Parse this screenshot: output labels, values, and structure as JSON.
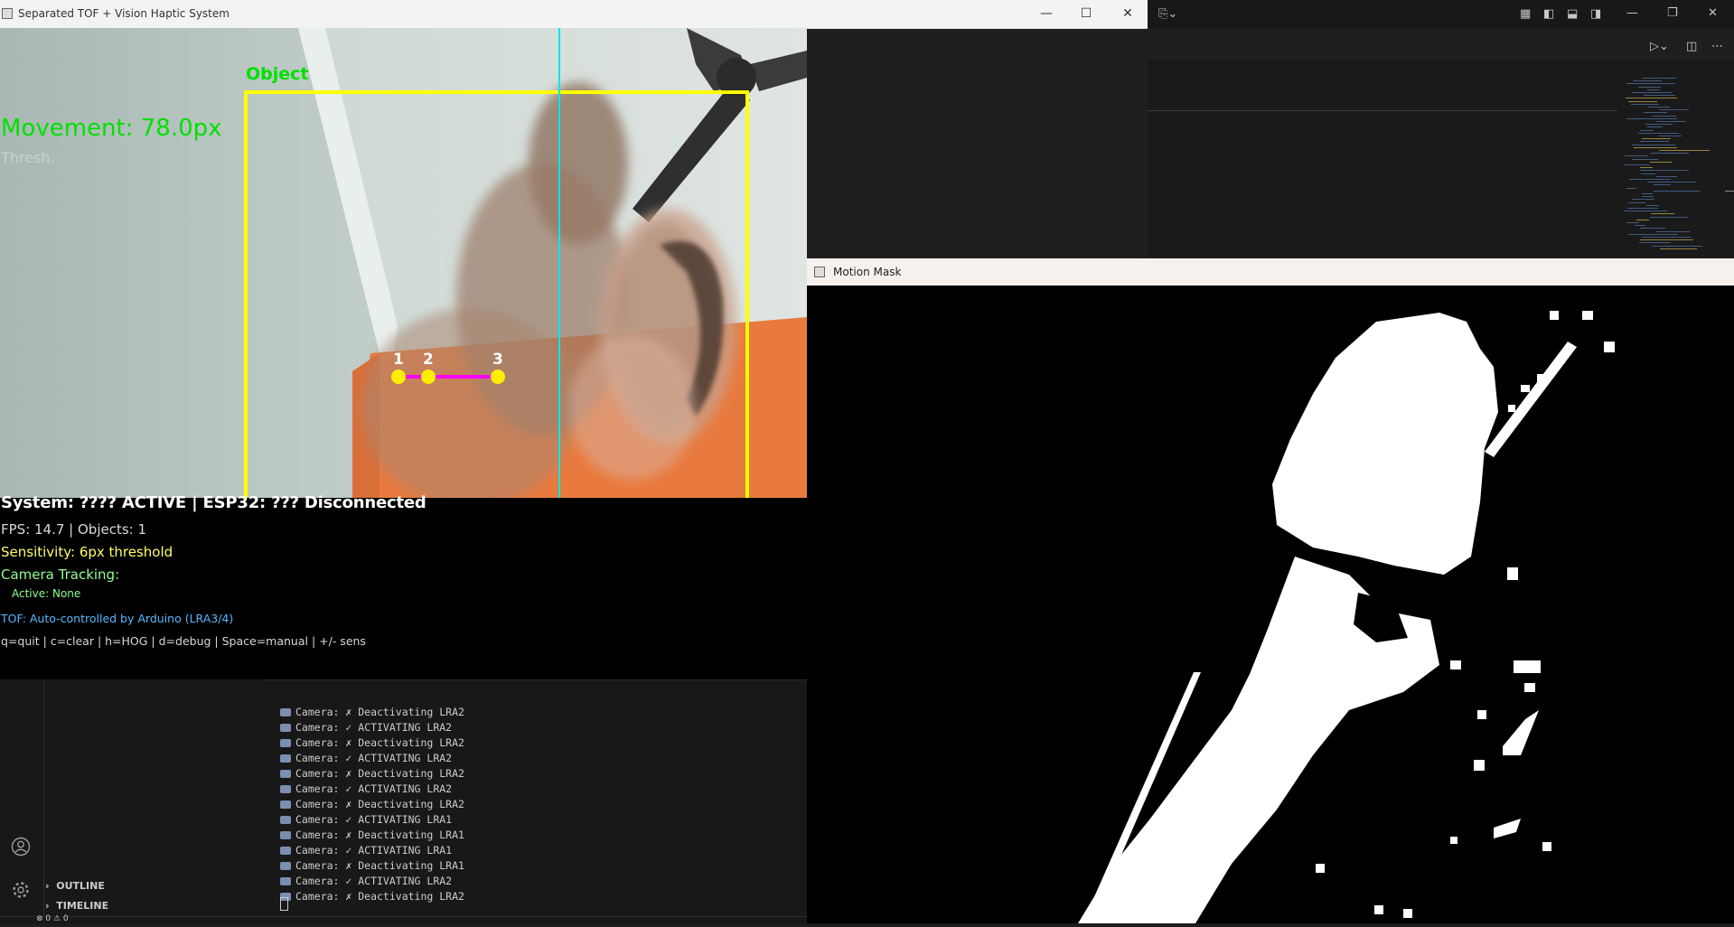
{
  "main_window": {
    "title": "Separated TOF + Vision Haptic System",
    "minimize": "—",
    "maximize": "☐",
    "close": "✕"
  },
  "camera_overlay": {
    "object_label": "Object",
    "movement": "Movement: 78.0px",
    "threshold_faint": "Thresh.",
    "points": [
      "1",
      "2",
      "3"
    ],
    "colors": {
      "box": "#ffff00",
      "movement_text": "#00e000",
      "center_line": "#00e6e6",
      "track_line": "#ff00ff",
      "points": "#ffee00"
    }
  },
  "hud": {
    "system_status": "System: ???? ACTIVE | ESP32: ??? Disconnected",
    "fps_objects": "FPS: 14.7 | Objects: 1",
    "sensitivity": "Sensitivity: 6px threshold",
    "camera_tracking": "Camera Tracking:",
    "active": "Active: None",
    "tof": "TOF: Auto-controlled by Arduino (LRA3/4)",
    "keys": "q=quit | c=clear | h=HOG | d=debug | Space=manual | +/- sens"
  },
  "mask_window": {
    "title": "Motion Mask"
  },
  "vscode": {
    "sections": [
      "OUTLINE",
      "TIMELINE"
    ],
    "status_left": "⊗ 0 ⚠ 0",
    "terminal_lines": [
      "Camera: ✗ Deactivating LRA2",
      "Camera: ✓ ACTIVATING LRA2",
      "Camera: ✗ Deactivating LRA2",
      "Camera: ✓ ACTIVATING LRA2",
      "Camera: ✗ Deactivating LRA2",
      "Camera: ✓ ACTIVATING LRA2",
      "Camera: ✗ Deactivating LRA2",
      "Camera: ✓ ACTIVATING LRA1",
      "Camera: ✗ Deactivating LRA1",
      "Camera: ✓ ACTIVATING LRA1",
      "Camera: ✗ Deactivating LRA1",
      "Camera: ✓ ACTIVATING LRA2",
      "Camera: ✗ Deactivating LRA2"
    ]
  }
}
